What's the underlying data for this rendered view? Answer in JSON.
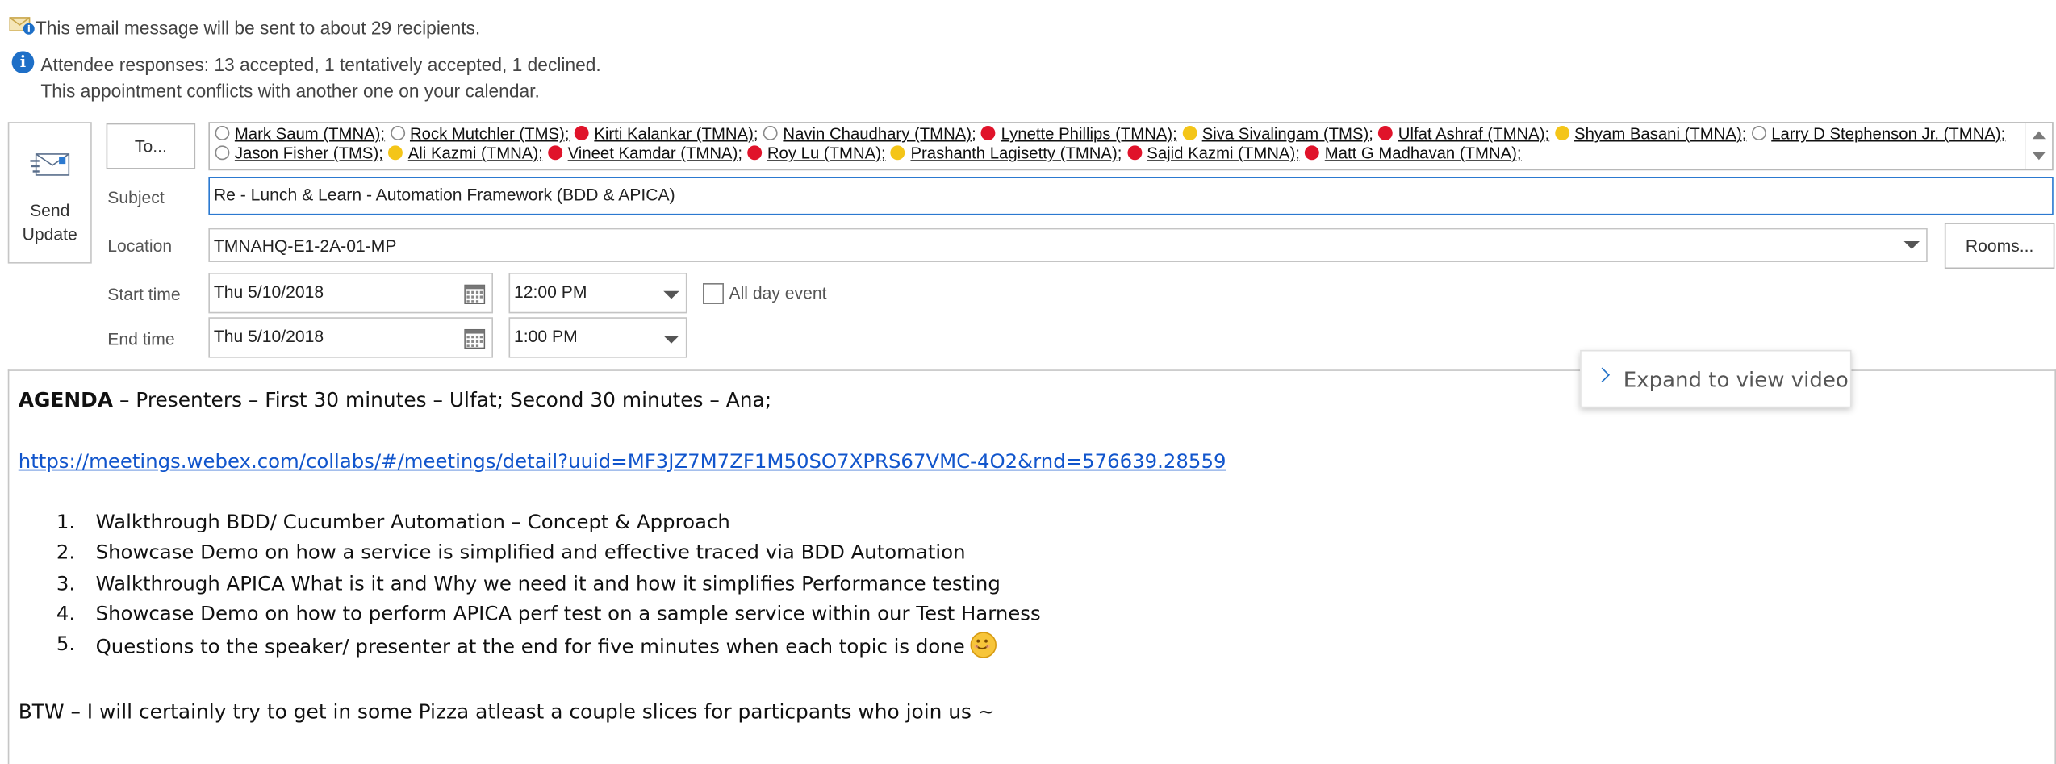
{
  "infobar": {
    "email_notice": "This email message will be sent to about 29 recipients.",
    "attendee_responses": "Attendee responses: 13 accepted, 1 tentatively accepted, 1 declined.",
    "conflict_notice": "This appointment conflicts with another one on your calendar."
  },
  "actions": {
    "send_update_label": "Send\nUpdate",
    "to_label": "To...",
    "rooms_label": "Rooms..."
  },
  "recipients": [
    {
      "name": "Mark Saum (TMNA);",
      "status": "none"
    },
    {
      "name": "Rock Mutchler (TMS);",
      "status": "none"
    },
    {
      "name": "Kirti Kalankar (TMNA);",
      "status": "accepted"
    },
    {
      "name": "Navin Chaudhary (TMNA);",
      "status": "none"
    },
    {
      "name": "Lynette Phillips (TMNA);",
      "status": "accepted"
    },
    {
      "name": "Siva Sivalingam (TMS);",
      "status": "tentative"
    },
    {
      "name": "Ulfat Ashraf (TMNA);",
      "status": "accepted"
    },
    {
      "name": "Shyam Basani (TMNA);",
      "status": "tentative"
    },
    {
      "name": "Larry D Stephenson Jr. (TMNA);",
      "status": "none"
    },
    {
      "name": "Jason Fisher (TMS);",
      "status": "none"
    },
    {
      "name": "Ali Kazmi (TMNA);",
      "status": "tentative"
    },
    {
      "name": "Vineet Kamdar (TMNA);",
      "status": "accepted"
    },
    {
      "name": "Roy Lu (TMNA);",
      "status": "accepted"
    },
    {
      "name": "Prashanth Lagisetty (TMNA);",
      "status": "tentative"
    },
    {
      "name": "Sajid Kazmi (TMNA);",
      "status": "accepted"
    },
    {
      "name": "Matt G Madhavan (TMNA);",
      "status": "accepted"
    }
  ],
  "form": {
    "subject_label": "Subject",
    "subject_value": "Re - Lunch & Learn - Automation Framework (BDD & APICA)",
    "location_label": "Location",
    "location_value": "TMNAHQ-E1-2A-01-MP",
    "start_label": "Start time",
    "start_date": "Thu 5/10/2018",
    "start_time": "12:00 PM",
    "end_label": "End time",
    "end_date": "Thu 5/10/2018",
    "end_time": "1:00 PM",
    "all_day_label": "All day event",
    "all_day_checked": false
  },
  "body": {
    "agenda_bold": "AGENDA",
    "agenda_rest": " – Presenters – First 30 minutes – Ulfat; Second 30 minutes – Ana;",
    "link": "https://meetings.webex.com/collabs/#/meetings/detail?uuid=MF3JZ7M7ZF1M50SO7XPRS67VMC-4O2&rnd=576639.28559",
    "items": [
      {
        "num": "1.",
        "text": "Walkthrough BDD/ Cucumber Automation – Concept & Approach"
      },
      {
        "num": "2.",
        "text": "Showcase Demo on how a service is simplified and effective traced via BDD Automation"
      },
      {
        "num": "3.",
        "text": "Walkthrough APICA What is it and Why we need it and how it simplifies Performance testing"
      },
      {
        "num": "4.",
        "text": "Showcase Demo on how to perform APICA perf test on a sample service within our Test Harness"
      },
      {
        "num": "5.",
        "text": "Questions to the speaker/ presenter at the end for five minutes when each topic is done"
      }
    ],
    "btw": "BTW – I will certainly try to get in some Pizza atleast a couple slices for particpants who join us ~"
  },
  "video_popup": {
    "label": "Expand to view video"
  },
  "colors": {
    "accepted": "#e0132a",
    "tentative": "#f4c518",
    "link": "#1155cc",
    "info_icon": "#1e6fc7"
  }
}
